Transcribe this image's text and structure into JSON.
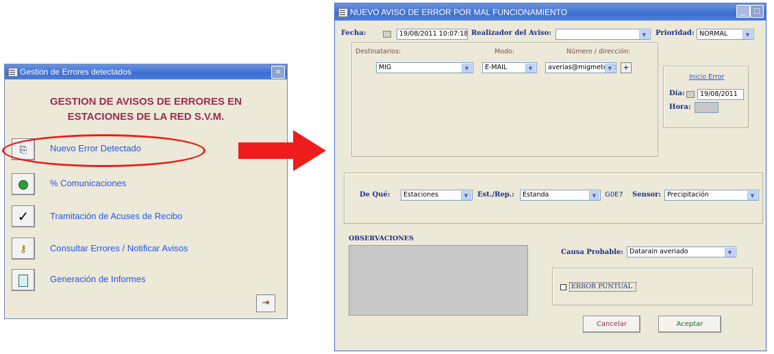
{
  "left_window": {
    "title": "Gestión de Errores detectados",
    "heading_line1": "GESTION DE AVISOS DE ERRORES EN",
    "heading_line2": "ESTACIONES DE LA RED S.V.M.",
    "menu": [
      {
        "label": "Nuevo Error Detectado",
        "icon": "new-document-icon"
      },
      {
        "label": "% Comunicaciones",
        "icon": "globe-icon"
      },
      {
        "label": "Tramitación de Acuses de Recibo",
        "icon": "checkmark-icon"
      },
      {
        "label": "Consultar Errores / Notificar Avisos",
        "icon": "key-icon"
      },
      {
        "label": "Generación de Informes",
        "icon": "notebook-icon"
      }
    ],
    "exit_icon": "exit-door-icon"
  },
  "right_window": {
    "title": "NUEVO AVISO DE ERROR POR MAL FUNCIONAMIENTO",
    "fecha_label": "Fecha:",
    "fecha_value": "19/08/2011 10:07:18",
    "realizador_label": "Realizador del Aviso:",
    "realizador_value": "",
    "prioridad_label": "Prioridad:",
    "prioridad_value": "NORMAL",
    "destinatarios_label": "Destinatarios:",
    "modo_label": "Modo:",
    "numero_label": "Número / dirección:",
    "destinatario_value": "MIG",
    "modo_value": "E-MAIL",
    "numero_value": "averias@migmeteo.cc",
    "add_label": "+",
    "inicio_error_label": "Inicio Error",
    "dia_label": "Día:",
    "dia_value": "19/08/2011",
    "hora_label": "Hora:",
    "hora_value": "",
    "deque_label": "De Qué:",
    "deque_value": "Estaciones",
    "estrep_label": "Est./Rep.:",
    "estrep_value": "Estanda",
    "estrep_code": "G0E7",
    "sensor_label": "Sensor:",
    "sensor_value": "Precipitación",
    "observaciones_label": "OBSERVACIONES",
    "causa_label": "Causa Probable:",
    "causa_value": "Datarain averiado",
    "error_puntual_label": "ERROR PUNTUAL",
    "cancel_label": "Cancelar",
    "accept_label": "Aceptar"
  },
  "colors": {
    "titlebar": "#3c6ed1",
    "heading": "#9b2b52",
    "menu_text": "#2a52e5",
    "highlight": "#ee1c1c",
    "arrow": "#ee1c1c",
    "form_label": "#1d2f85",
    "window_bg": "#ece9d8"
  }
}
